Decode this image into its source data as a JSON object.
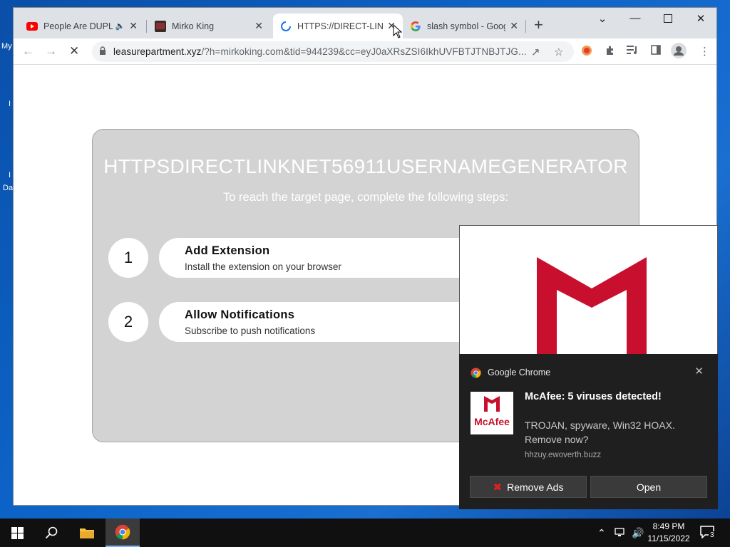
{
  "desktop": {
    "labels": [
      "My",
      "I",
      "I",
      "Da"
    ]
  },
  "browser": {
    "tabs": [
      {
        "title": "People Are DUPL",
        "icon": "youtube-icon",
        "has_audio": true
      },
      {
        "title": "Mirko King",
        "icon": "site-thumbnail-icon"
      },
      {
        "title": "HTTPS://DIRECT-LIN",
        "icon": "loading-spinner-icon",
        "active": true
      },
      {
        "title": "slash symbol - Goog",
        "icon": "google-icon"
      }
    ],
    "url": {
      "host": "leasurepartment.xyz",
      "rest": "/?h=mirkoking.com&tid=944239&cc=eyJ0aXRsZSI6IkhUVFBTJTNBJTJG..."
    }
  },
  "page": {
    "title": "HTTPSDIRECTLINKNET56911USERNAMEGENERATOR",
    "subtitle": "To reach the target page, complete the following steps:",
    "steps": [
      {
        "number": "1",
        "title": "Add Extension",
        "description": "Install the extension on your browser"
      },
      {
        "number": "2",
        "title": "Allow Notifications",
        "description": "Subscribe to push notifications"
      }
    ]
  },
  "notification": {
    "app_name": "Google Chrome",
    "title": "McAfee: 5 viruses detected!",
    "body": "TROJAN, spyware, Win32 HOAX. Remove now?",
    "source": "hhzuy.ewoverth.buzz",
    "thumb_text": "McAfee",
    "buttons": {
      "remove": "Remove Ads",
      "open": "Open"
    },
    "brand_color": "#c8102e"
  },
  "taskbar": {
    "time": "8:49 PM",
    "date": "11/15/2022",
    "notification_count": "3"
  }
}
